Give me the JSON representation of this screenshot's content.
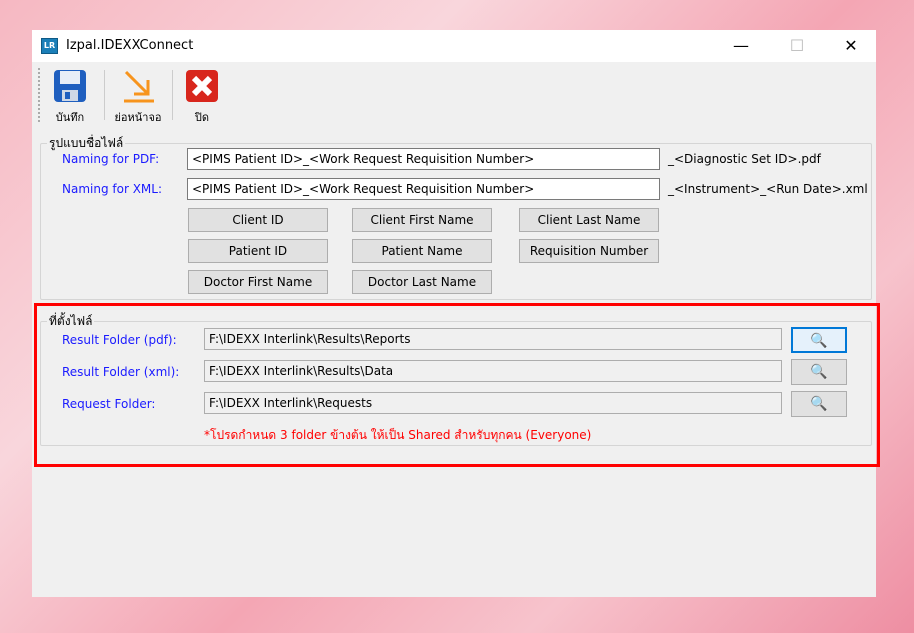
{
  "window": {
    "title": "Izpal.IDEXXConnect",
    "app_icon": "LR",
    "minimize": "—",
    "maximize": "☐",
    "close": "✕"
  },
  "toolbar": {
    "save": "บันทึก",
    "minimize": "ย่อหน้าจอ",
    "close": "ปิด"
  },
  "naming": {
    "legend": "รูปแบบชื่อไฟล์",
    "pdf_label": "Naming for PDF:",
    "pdf_value": "<PIMS Patient ID>_<Work Request Requisition Number>",
    "pdf_suffix": "_<Diagnostic Set ID>.pdf",
    "xml_label": "Naming for XML:",
    "xml_value": "<PIMS Patient ID>_<Work Request Requisition Number>",
    "xml_suffix": "_<Instrument>_<Run Date>.xml",
    "buttons": [
      "Client ID",
      "Client First Name",
      "Client Last Name",
      "Patient ID",
      "Patient Name",
      "Requisition Number",
      "Doctor First Name",
      "Doctor Last Name"
    ]
  },
  "folders": {
    "legend": "ที่ตั้งไฟล์",
    "rows": [
      {
        "label": "Result Folder (pdf):",
        "value": "F:\\IDEXX Interlink\\Results\\Reports"
      },
      {
        "label": "Result Folder (xml):",
        "value": "F:\\IDEXX Interlink\\Results\\Data"
      },
      {
        "label": "Request Folder:",
        "value": "F:\\IDEXX Interlink\\Requests"
      }
    ],
    "note": "*โปรดกำหนด 3 folder ข้างต้น ให้เป็น Shared สำหรับทุกคน (Everyone)"
  },
  "colors": {
    "label": "#1a1aff",
    "note": "#ff0000",
    "highlight": "#ff0000"
  }
}
